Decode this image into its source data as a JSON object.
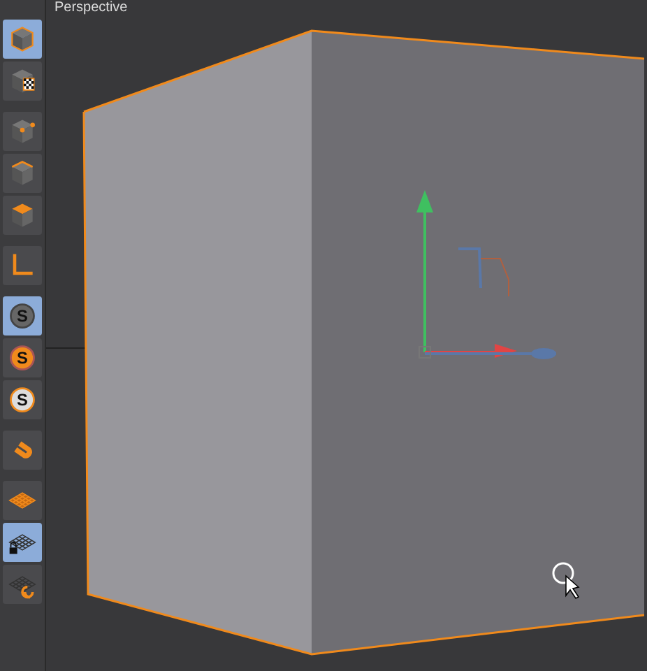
{
  "viewport": {
    "title": "Perspective"
  },
  "toolbar": [
    [
      {
        "kind": "model",
        "selected": true
      },
      {
        "kind": "texture",
        "selected": false
      }
    ],
    [
      {
        "kind": "points",
        "selected": false
      },
      {
        "kind": "edges",
        "selected": false
      },
      {
        "kind": "polygons",
        "selected": false
      }
    ],
    [
      {
        "kind": "axis",
        "selected": false
      }
    ],
    [
      {
        "kind": "snap",
        "glyph": "S",
        "selected": true
      },
      {
        "kind": "snap-on",
        "glyph": "S",
        "selected": false
      },
      {
        "kind": "snap-ring",
        "glyph": "S",
        "selected": false
      }
    ],
    [
      {
        "kind": "magnet",
        "selected": false
      }
    ],
    [
      {
        "kind": "workplane",
        "selected": false
      },
      {
        "kind": "workplane-lock",
        "selected": true
      },
      {
        "kind": "workplane-sync",
        "selected": false
      }
    ]
  ]
}
